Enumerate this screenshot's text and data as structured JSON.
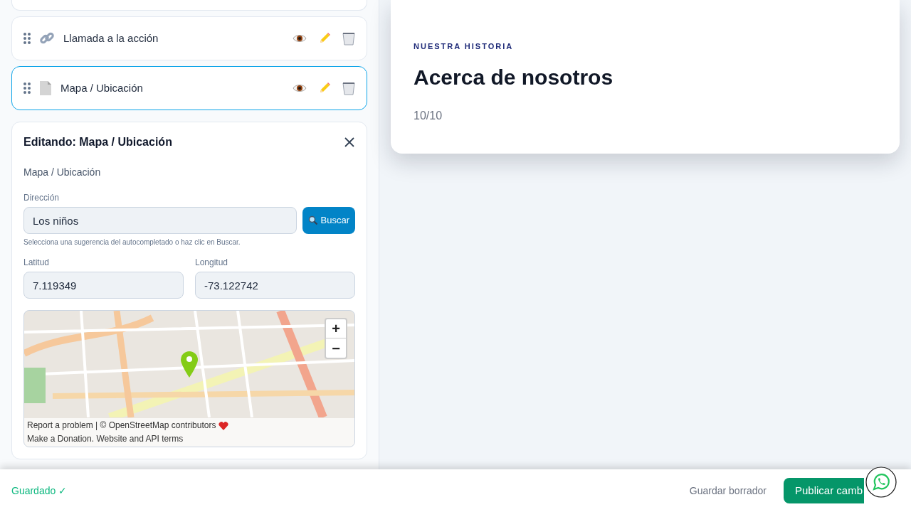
{
  "blocks": [
    {
      "label": "Llamada a la acción",
      "kind": "link",
      "selected": false
    },
    {
      "label": "Mapa / Ubicación",
      "kind": "document",
      "selected": true
    }
  ],
  "editor": {
    "title": "Editando: Mapa / Ubicación",
    "subtitle": "Mapa / Ubicación",
    "address": {
      "label": "Dirección",
      "value": "Los niños"
    },
    "search_button": "Buscar",
    "hint": "Selecciona una sugerencia del autocompletado o haz clic en Buscar.",
    "latitude": {
      "label": "Latitud",
      "value": "7.119349"
    },
    "longitude": {
      "label": "Longitud",
      "value": "-73.122742"
    },
    "map": {
      "zoom_in": "+",
      "zoom_out": "−",
      "attribution": "Report a problem | © OpenStreetMap contributors",
      "attribution_2": "Make a Donation. Website and API terms"
    }
  },
  "preview": {
    "eyebrow": "NUESTRA HISTORIA",
    "heading": "Acerca de nosotros",
    "text": "10/10"
  },
  "footer": {
    "status": "Guardado ✓",
    "draft_button": "Guardar borrador",
    "publish_button": "Publicar camb"
  }
}
